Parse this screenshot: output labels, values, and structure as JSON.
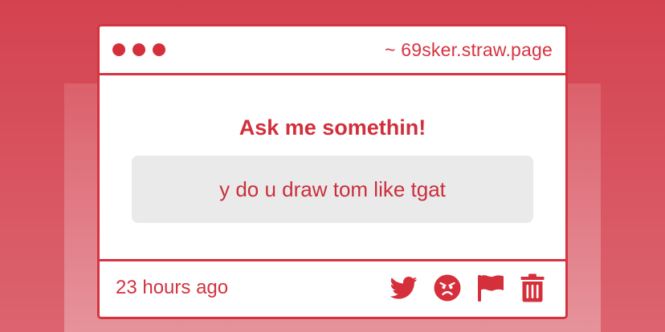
{
  "header": {
    "site_label": "~ 69sker.straw.page"
  },
  "main": {
    "heading": "Ask me somethin!",
    "question": "y do u draw tom like tgat"
  },
  "footer": {
    "timestamp": "23 hours ago",
    "actions": [
      {
        "icon": "twitter-icon"
      },
      {
        "icon": "angry-face-icon"
      },
      {
        "icon": "flag-icon"
      },
      {
        "icon": "trash-icon"
      }
    ]
  },
  "colors": {
    "accent": "#d63340",
    "background": "#d4424f",
    "question_box": "#ebeaeb"
  }
}
